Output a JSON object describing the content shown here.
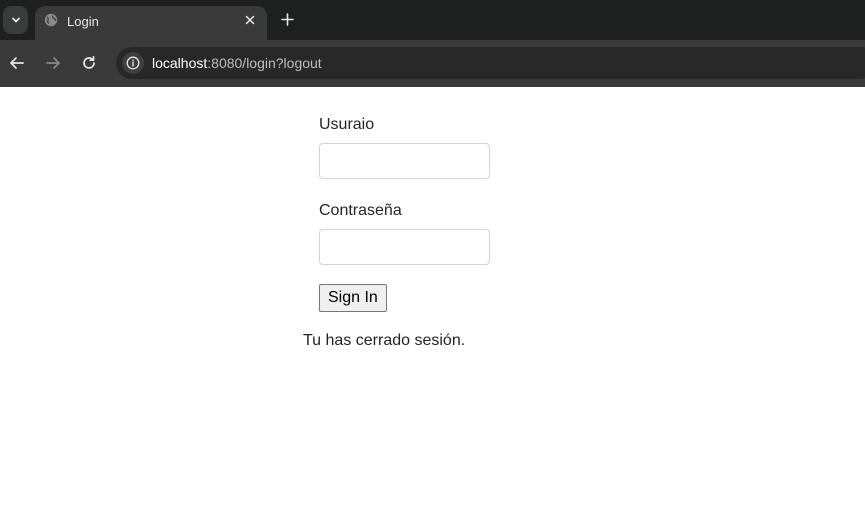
{
  "browser": {
    "tab_title": "Login",
    "url_host": "localhost",
    "url_rest": ":8080/login?logout"
  },
  "form": {
    "username_label": "Usuraio",
    "username_value": "",
    "password_label": "Contraseña",
    "password_value": "",
    "submit_label": "Sign In"
  },
  "message": "Tu has cerrado sesión."
}
